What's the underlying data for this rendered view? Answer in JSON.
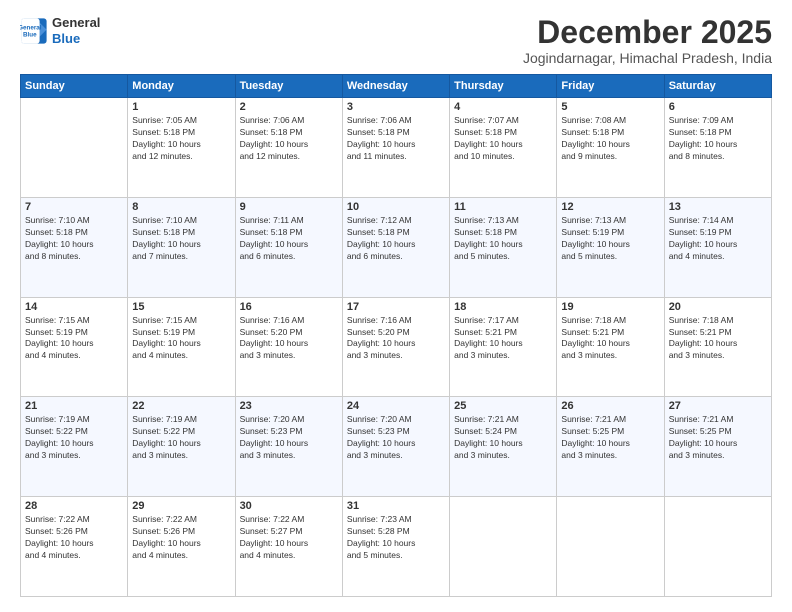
{
  "logo": {
    "line1": "General",
    "line2": "Blue"
  },
  "header": {
    "title": "December 2025",
    "subtitle": "Jogindarnagar, Himachal Pradesh, India"
  },
  "weekdays": [
    "Sunday",
    "Monday",
    "Tuesday",
    "Wednesday",
    "Thursday",
    "Friday",
    "Saturday"
  ],
  "weeks": [
    [
      {
        "day": "",
        "info": ""
      },
      {
        "day": "1",
        "info": "Sunrise: 7:05 AM\nSunset: 5:18 PM\nDaylight: 10 hours\nand 12 minutes."
      },
      {
        "day": "2",
        "info": "Sunrise: 7:06 AM\nSunset: 5:18 PM\nDaylight: 10 hours\nand 12 minutes."
      },
      {
        "day": "3",
        "info": "Sunrise: 7:06 AM\nSunset: 5:18 PM\nDaylight: 10 hours\nand 11 minutes."
      },
      {
        "day": "4",
        "info": "Sunrise: 7:07 AM\nSunset: 5:18 PM\nDaylight: 10 hours\nand 10 minutes."
      },
      {
        "day": "5",
        "info": "Sunrise: 7:08 AM\nSunset: 5:18 PM\nDaylight: 10 hours\nand 9 minutes."
      },
      {
        "day": "6",
        "info": "Sunrise: 7:09 AM\nSunset: 5:18 PM\nDaylight: 10 hours\nand 8 minutes."
      }
    ],
    [
      {
        "day": "7",
        "info": "Sunrise: 7:10 AM\nSunset: 5:18 PM\nDaylight: 10 hours\nand 8 minutes."
      },
      {
        "day": "8",
        "info": "Sunrise: 7:10 AM\nSunset: 5:18 PM\nDaylight: 10 hours\nand 7 minutes."
      },
      {
        "day": "9",
        "info": "Sunrise: 7:11 AM\nSunset: 5:18 PM\nDaylight: 10 hours\nand 6 minutes."
      },
      {
        "day": "10",
        "info": "Sunrise: 7:12 AM\nSunset: 5:18 PM\nDaylight: 10 hours\nand 6 minutes."
      },
      {
        "day": "11",
        "info": "Sunrise: 7:13 AM\nSunset: 5:18 PM\nDaylight: 10 hours\nand 5 minutes."
      },
      {
        "day": "12",
        "info": "Sunrise: 7:13 AM\nSunset: 5:19 PM\nDaylight: 10 hours\nand 5 minutes."
      },
      {
        "day": "13",
        "info": "Sunrise: 7:14 AM\nSunset: 5:19 PM\nDaylight: 10 hours\nand 4 minutes."
      }
    ],
    [
      {
        "day": "14",
        "info": "Sunrise: 7:15 AM\nSunset: 5:19 PM\nDaylight: 10 hours\nand 4 minutes."
      },
      {
        "day": "15",
        "info": "Sunrise: 7:15 AM\nSunset: 5:19 PM\nDaylight: 10 hours\nand 4 minutes."
      },
      {
        "day": "16",
        "info": "Sunrise: 7:16 AM\nSunset: 5:20 PM\nDaylight: 10 hours\nand 3 minutes."
      },
      {
        "day": "17",
        "info": "Sunrise: 7:16 AM\nSunset: 5:20 PM\nDaylight: 10 hours\nand 3 minutes."
      },
      {
        "day": "18",
        "info": "Sunrise: 7:17 AM\nSunset: 5:21 PM\nDaylight: 10 hours\nand 3 minutes."
      },
      {
        "day": "19",
        "info": "Sunrise: 7:18 AM\nSunset: 5:21 PM\nDaylight: 10 hours\nand 3 minutes."
      },
      {
        "day": "20",
        "info": "Sunrise: 7:18 AM\nSunset: 5:21 PM\nDaylight: 10 hours\nand 3 minutes."
      }
    ],
    [
      {
        "day": "21",
        "info": "Sunrise: 7:19 AM\nSunset: 5:22 PM\nDaylight: 10 hours\nand 3 minutes."
      },
      {
        "day": "22",
        "info": "Sunrise: 7:19 AM\nSunset: 5:22 PM\nDaylight: 10 hours\nand 3 minutes."
      },
      {
        "day": "23",
        "info": "Sunrise: 7:20 AM\nSunset: 5:23 PM\nDaylight: 10 hours\nand 3 minutes."
      },
      {
        "day": "24",
        "info": "Sunrise: 7:20 AM\nSunset: 5:23 PM\nDaylight: 10 hours\nand 3 minutes."
      },
      {
        "day": "25",
        "info": "Sunrise: 7:21 AM\nSunset: 5:24 PM\nDaylight: 10 hours\nand 3 minutes."
      },
      {
        "day": "26",
        "info": "Sunrise: 7:21 AM\nSunset: 5:25 PM\nDaylight: 10 hours\nand 3 minutes."
      },
      {
        "day": "27",
        "info": "Sunrise: 7:21 AM\nSunset: 5:25 PM\nDaylight: 10 hours\nand 3 minutes."
      }
    ],
    [
      {
        "day": "28",
        "info": "Sunrise: 7:22 AM\nSunset: 5:26 PM\nDaylight: 10 hours\nand 4 minutes."
      },
      {
        "day": "29",
        "info": "Sunrise: 7:22 AM\nSunset: 5:26 PM\nDaylight: 10 hours\nand 4 minutes."
      },
      {
        "day": "30",
        "info": "Sunrise: 7:22 AM\nSunset: 5:27 PM\nDaylight: 10 hours\nand 4 minutes."
      },
      {
        "day": "31",
        "info": "Sunrise: 7:23 AM\nSunset: 5:28 PM\nDaylight: 10 hours\nand 5 minutes."
      },
      {
        "day": "",
        "info": ""
      },
      {
        "day": "",
        "info": ""
      },
      {
        "day": "",
        "info": ""
      }
    ]
  ]
}
